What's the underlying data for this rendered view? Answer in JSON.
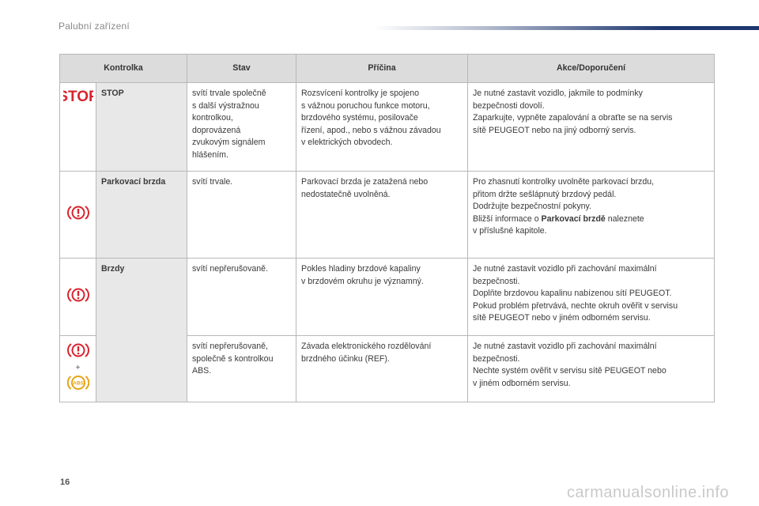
{
  "header": {
    "title": "Palubní zařízení"
  },
  "table": {
    "columns": [
      "Kontrolka",
      "Stav",
      "Příčina",
      "Akce/Doporučení"
    ],
    "rows": [
      {
        "icon": "stop-icon",
        "icon_text": "STOP",
        "name": "STOP",
        "state": [
          "svítí trvale společně",
          "s další výstražnou",
          "kontrolkou,",
          "doprovázená",
          "zvukovým signálem",
          "hlášením."
        ],
        "cause": [
          "Rozsvícení kontrolky je spojeno",
          "s vážnou poruchou funkce motoru,",
          "brzdového systému, posilovače",
          "řízení, apod., nebo s vážnou závadou",
          "v elektrických obvodech."
        ],
        "action": [
          "Je nutné zastavit vozidlo, jakmile to podmínky",
          "bezpečnosti dovolí.",
          "Zaparkujte, vypněte zapalování a obraťte se na servis",
          "sítě PEUGEOT nebo na jiný odborný servis."
        ]
      },
      {
        "icon": "brake-warning-icon",
        "name": "Parkovací brzda",
        "state": [
          "svítí trvale."
        ],
        "cause": [
          "Parkovací brzda je zatažená nebo",
          "nedostatečně uvolněná."
        ],
        "action": [
          "Pro zhasnutí kontrolky uvolněte parkovací brzdu,",
          "přitom držte sešlápnutý brzdový pedál.",
          "Dodržujte bezpečnostní pokyny."
        ],
        "action_last": {
          "prefix": "Bližší informace o ",
          "bold": "Parkovací brzdě",
          "suffix": " naleznete"
        },
        "action_tail": "v příslušné kapitole."
      },
      {
        "icon": "brake-warning-icon",
        "name": "Brzdy",
        "state": [
          "svítí nepřerušovaně."
        ],
        "cause": [
          "Pokles hladiny brzdové kapaliny",
          "v brzdovém okruhu je významný."
        ],
        "action": [
          "Je nutné zastavit vozidlo při zachování maximální",
          "bezpečnosti.",
          "Doplňte brzdovou kapalinu nabízenou sítí PEUGEOT.",
          "Pokud problém přetrvává, nechte okruh ověřit v servisu",
          "sítě PEUGEOT nebo v jiném odborném servisu."
        ]
      },
      {
        "icon": "brake-and-abs-icon",
        "plus": "+",
        "abs_text": "ABS",
        "state": [
          "svítí nepřerušovaně,",
          "společně s kontrolkou",
          "ABS."
        ],
        "cause": [
          "Závada elektronického rozdělování",
          "brzdného účinku (REF)."
        ],
        "action": [
          "Je nutné zastavit vozidlo při zachování maximální",
          "bezpečnosti.",
          "Nechte systém ověřit v servisu sítě PEUGEOT nebo",
          "v jiném odborném servisu."
        ]
      }
    ]
  },
  "footer": {
    "page_number": "16",
    "watermark": "carmanualsonline.info"
  },
  "colors": {
    "warning_red": "#d9232d",
    "abs_amber": "#e8a317",
    "header_bar": "#1e376e"
  }
}
